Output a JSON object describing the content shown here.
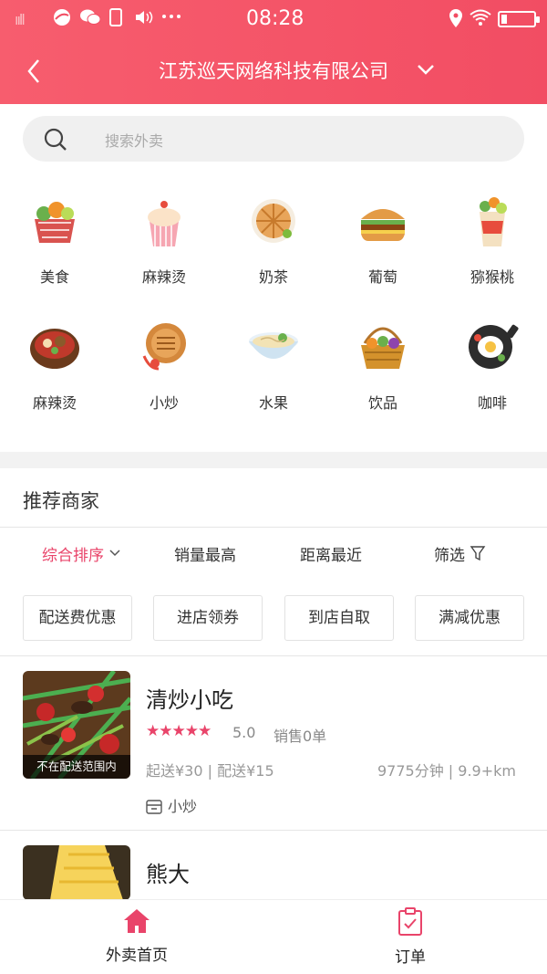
{
  "status_bar": {
    "signal": "ııll",
    "icons": [
      "browser-icon",
      "wechat-icon",
      "phone-icon",
      "volume-icon",
      "more-icon"
    ],
    "time": "08:28",
    "right_icons": [
      "location-icon",
      "wifi-icon",
      "battery-icon"
    ]
  },
  "header": {
    "title": "江苏巡天网络科技有限公司"
  },
  "search": {
    "placeholder": "搜索外卖"
  },
  "categories": [
    {
      "label": "美食",
      "icon": "food-basket-icon"
    },
    {
      "label": "麻辣烫",
      "icon": "cupcake-icon"
    },
    {
      "label": "奶茶",
      "icon": "pancake-icon"
    },
    {
      "label": "葡萄",
      "icon": "burger-icon"
    },
    {
      "label": "猕猴桃",
      "icon": "wrap-icon"
    },
    {
      "label": "麻辣烫",
      "icon": "hotpot-icon"
    },
    {
      "label": "小炒",
      "icon": "pie-icon"
    },
    {
      "label": "水果",
      "icon": "noodle-bowl-icon"
    },
    {
      "label": "饮品",
      "icon": "fruit-basket-icon"
    },
    {
      "label": "咖啡",
      "icon": "fried-egg-pan-icon"
    }
  ],
  "recommend": {
    "title": "推荐商家",
    "sorts": [
      "综合排序",
      "销量最高",
      "距离最近",
      "筛选"
    ],
    "chips": [
      "配送费优惠",
      "进店领券",
      "到店自取",
      "满减优惠"
    ]
  },
  "shops": [
    {
      "name": "清炒小吃",
      "stars": "★★★★★",
      "rating": "5.0",
      "sales": "销售0单",
      "tag": "不在配送范围内",
      "fees": "起送¥30 | 配送¥15",
      "distance": "9775分钟 | 9.9+km",
      "category": "小炒"
    },
    {
      "name": "熊大"
    }
  ],
  "bottom_nav": {
    "home": "外卖首页",
    "orders": "订单"
  },
  "colors": {
    "brand": "#f24d63",
    "accent": "#e9446a"
  }
}
